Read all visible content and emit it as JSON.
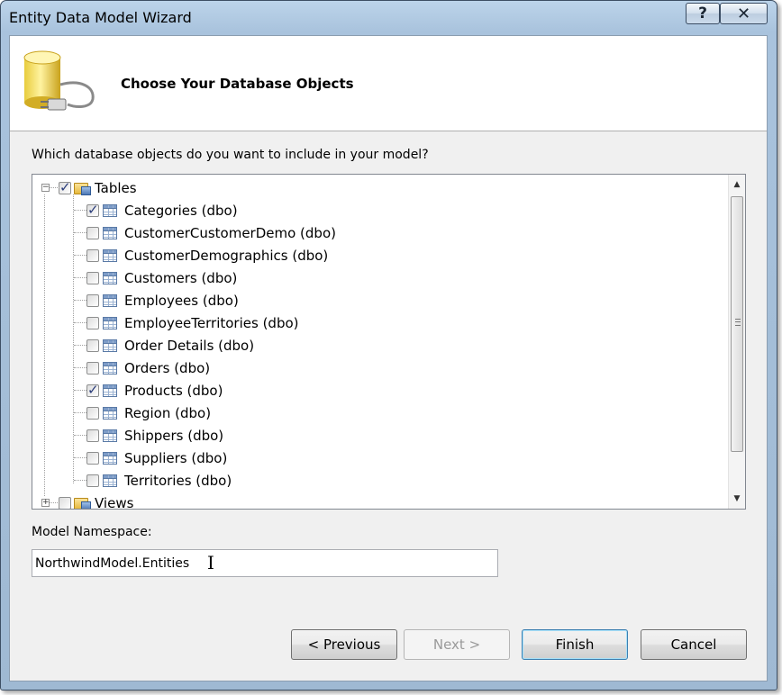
{
  "window": {
    "title": "Entity Data Model Wizard",
    "help_glyph": "?",
    "close_glyph": "✕"
  },
  "header": {
    "title": "Choose Your Database Objects",
    "icon": "database-plug-icon"
  },
  "question": "Which database objects do you want to include in your model?",
  "tree": {
    "root": {
      "label": "Tables",
      "checked": true,
      "expanded": true,
      "expander": "−"
    },
    "tables": [
      {
        "label": "Categories (dbo)",
        "checked": true
      },
      {
        "label": "CustomerCustomerDemo (dbo)",
        "checked": false
      },
      {
        "label": "CustomerDemographics (dbo)",
        "checked": false
      },
      {
        "label": "Customers (dbo)",
        "checked": false
      },
      {
        "label": "Employees (dbo)",
        "checked": false
      },
      {
        "label": "EmployeeTerritories (dbo)",
        "checked": false
      },
      {
        "label": "Order Details (dbo)",
        "checked": false
      },
      {
        "label": "Orders (dbo)",
        "checked": false
      },
      {
        "label": "Products (dbo)",
        "checked": true
      },
      {
        "label": "Region (dbo)",
        "checked": false
      },
      {
        "label": "Shippers (dbo)",
        "checked": false
      },
      {
        "label": "Suppliers (dbo)",
        "checked": false
      },
      {
        "label": "Territories (dbo)",
        "checked": false
      }
    ],
    "views": {
      "label": "Views",
      "checked": false,
      "expanded": false,
      "expander": "+"
    },
    "scroll_up_glyph": "▲",
    "scroll_down_glyph": "▼"
  },
  "namespace": {
    "label": "Model Namespace:",
    "value": "NorthwindModel.Entities",
    "cursor_glyph": "I"
  },
  "buttons": {
    "previous": "< Previous",
    "next": "Next >",
    "finish": "Finish",
    "cancel": "Cancel"
  }
}
